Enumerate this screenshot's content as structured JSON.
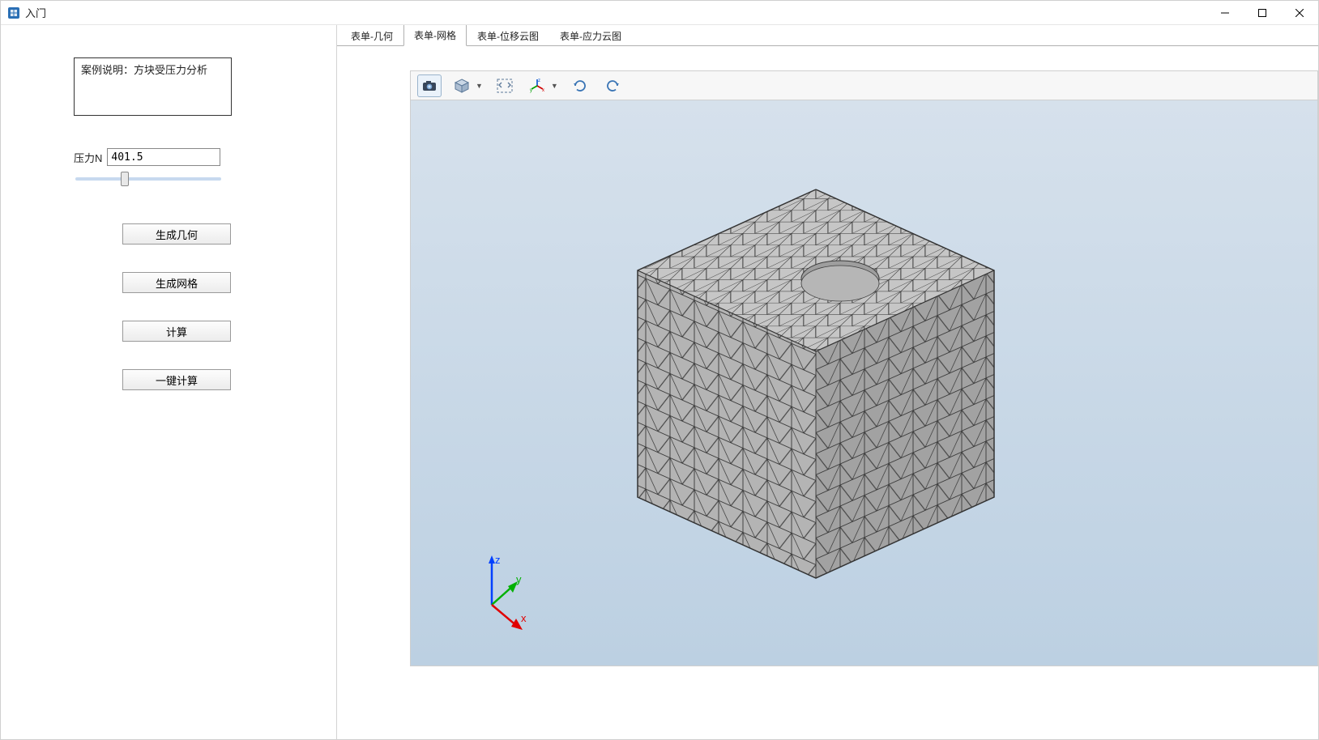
{
  "window": {
    "title": "入门"
  },
  "sidebar": {
    "description": "案例说明：方块受压力分析",
    "force_label": "压力N",
    "force_value": "401.5",
    "slider_min": 0,
    "slider_max": 1000,
    "slider_value": 330,
    "buttons": {
      "gen_geom": "生成几何",
      "gen_mesh": "生成网格",
      "compute": "计算",
      "one_click": "一键计算"
    }
  },
  "tabs": [
    {
      "id": "geom",
      "label": "表单-几何",
      "active": false
    },
    {
      "id": "mesh",
      "label": "表单-网格",
      "active": true
    },
    {
      "id": "disp",
      "label": "表单-位移云图",
      "active": false
    },
    {
      "id": "stress",
      "label": "表单-应力云图",
      "active": false
    }
  ],
  "toolbar": {
    "camera": "camera-icon",
    "box_view": "box-view-icon",
    "fit": "fit-view-icon",
    "axes": "axes-icon",
    "rotate_cw": "rotate-cw-icon",
    "rotate_ccw": "rotate-ccw-icon"
  },
  "axis_labels": {
    "x": "x",
    "y": "y",
    "z": "z"
  }
}
